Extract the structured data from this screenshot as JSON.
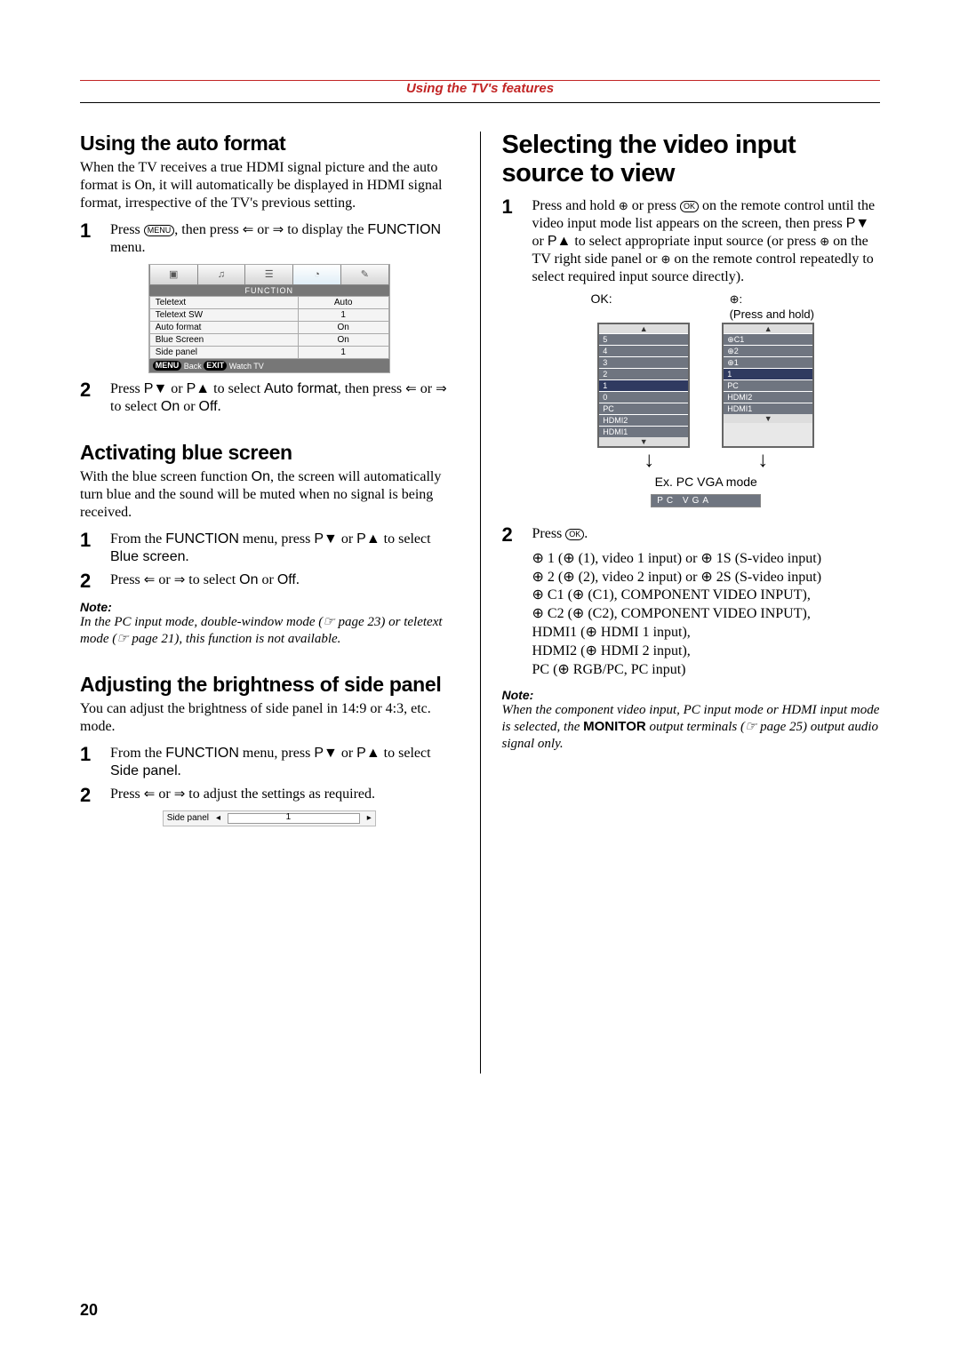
{
  "header": {
    "title": "Using the TV's features"
  },
  "left": {
    "autoFormat": {
      "heading": "Using the auto format",
      "intro": "When the TV receives a true HDMI signal picture and the auto format is On, it will automatically be displayed in HDMI signal format, irrespective of the TV's previous setting.",
      "step1_a": "Press ",
      "step1_btn_menu": "MENU",
      "step1_b": ", then press ",
      "step1_c": " or ",
      "step1_d": " to display the ",
      "step1_func": "FUNCTION",
      "step1_e": " menu.",
      "step2_a": "Press ",
      "step2_pdown": "P▼",
      "step2_b": " or ",
      "step2_pup": "P▲",
      "step2_c": " to select ",
      "step2_item": "Auto format",
      "step2_d": ", then press ",
      "step2_e": " or ",
      "step2_f": " to select ",
      "step2_on": "On",
      "step2_g": " or ",
      "step2_off": "Off",
      "step2_h": "."
    },
    "functionMenu": {
      "header": "FUNCTION",
      "rows": [
        {
          "label": "Teletext",
          "value": "Auto"
        },
        {
          "label": "Teletext SW",
          "value": "1"
        },
        {
          "label": "Auto format",
          "value": "On"
        },
        {
          "label": "Blue Screen",
          "value": "On"
        },
        {
          "label": "Side panel",
          "value": "1"
        }
      ],
      "footer_back": "MENU",
      "footer_back_label": " Back   ",
      "footer_exit": "EXIT",
      "footer_exit_label": " Watch TV"
    },
    "blueScreen": {
      "heading": "Activating blue screen",
      "intro_a": "With the blue screen function ",
      "intro_on": "On",
      "intro_b": ", the screen will automatically turn blue and the sound will be muted when no signal is being received.",
      "step1_a": "From the ",
      "step1_func": "FUNCTION",
      "step1_b": " menu, press ",
      "step1_pdown": "P▼",
      "step1_c": " or ",
      "step1_pup": "P▲",
      "step1_d": " to select ",
      "step1_item": "Blue screen",
      "step1_e": ".",
      "step2_a": "Press ",
      "step2_b": " or ",
      "step2_c": " to select ",
      "step2_on": "On",
      "step2_d": " or ",
      "step2_off": "Off",
      "step2_e": ".",
      "note_label": "Note:",
      "note_text": "In the PC input mode, double-window mode (☞ page 23) or teletext mode (☞ page 21), this function is not available."
    },
    "sidePanel": {
      "heading": "Adjusting the brightness of side panel",
      "intro": "You can adjust the brightness of side panel in 14:9 or 4:3, etc. mode.",
      "step1_a": "From the ",
      "step1_func": "FUNCTION",
      "step1_b": " menu, press ",
      "step1_pdown": "P▼",
      "step1_c": " or ",
      "step1_pup": "P▲",
      "step1_d": " to select ",
      "step1_item": "Side panel",
      "step1_e": ".",
      "step2_a": "Press ",
      "step2_b": " or ",
      "step2_c": " to adjust the settings as required.",
      "slider_label": "Side panel",
      "slider_value": "1"
    }
  },
  "right": {
    "heading": "Selecting the video input source to view",
    "step1_a": "Press and hold ",
    "step1_b": " or press ",
    "step1_ok": "OK",
    "step1_c": " on the remote control until the video input mode list appears on the screen, then press ",
    "step1_pdown": "P▼",
    "step1_d": " or ",
    "step1_pup": "P▲",
    "step1_e": " to select appropriate input source (or press ",
    "step1_f": " on the TV right side panel or ",
    "step1_g": " on the remote control repeatedly to select required input source directly).",
    "ok_label": "OK:",
    "input_icon_label": "⊕:",
    "press_and_hold": "(Press and hold)",
    "leftList": [
      "5",
      "4",
      "3",
      "2",
      "1",
      "0",
      "PC",
      "HDMI2",
      "HDMI1"
    ],
    "leftSelected": "1",
    "rightList": [
      "⊕C1",
      "⊕2",
      "⊕1",
      "1",
      "PC",
      "HDMI2",
      "HDMI1"
    ],
    "rightSelected": "1",
    "ex_label": "Ex. ",
    "ex_value": "PC VGA mode",
    "pcvga": "PC   VGA",
    "step2_a": "Press ",
    "step2_ok": "OK",
    "step2_b": ".",
    "inputs": [
      "⊕ 1 (⊕ (1), video 1 input) or ⊕ 1S (S-video input)",
      "⊕ 2 (⊕ (2), video 2 input) or ⊕ 2S (S-video input)",
      "⊕ C1 (⊕ (C1), COMPONENT VIDEO INPUT),",
      "⊕ C2 (⊕ (C2), COMPONENT VIDEO INPUT),",
      "HDMI1 (⊕ HDMI 1 input),",
      "HDMI2 (⊕ HDMI 2 input),",
      "PC (⊕ RGB/PC, PC input)"
    ],
    "note_label": "Note:",
    "note_text_a": "When the component video input, PC input mode or HDMI input mode is selected, the ",
    "note_bold": "MONITOR",
    "note_text_b": " output terminals (☞ page 25) output audio signal only."
  },
  "pageNumber": "20",
  "glyphs": {
    "volMinus": "⇐",
    "volPlus": "⇒",
    "input": "⊕"
  }
}
